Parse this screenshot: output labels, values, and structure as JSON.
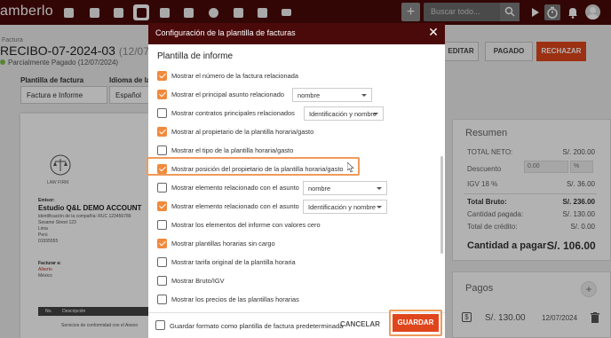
{
  "app": {
    "brand": "amberlo"
  },
  "topbar": {
    "search_placeholder": "Buscar todo...",
    "add_label": "+"
  },
  "document": {
    "label": "Factura",
    "title": "RECIBO-07-2024-03",
    "title_date": "(12/07/2024)",
    "status": "Parcialmente Pagado (12/07/2024)",
    "buttons": {
      "edit": "EDITAR",
      "paid": "PAGADO",
      "reject": "RECHAZAR"
    },
    "template_label": "Plantilla de factura",
    "template_value": "Factura e Informe",
    "language_label": "Idioma de la",
    "language_value": "Español"
  },
  "paper": {
    "firm_name": "LAW FIRM",
    "emisor_label": "Emisor:",
    "emisor_name": "Estudio Q&L DEMO ACCOUNT",
    "company_id": "identificación de la compañía: RUC 123456789",
    "street": "Sesame Street 123",
    "city": "Lima",
    "country": "Perú",
    "phone": "01555555",
    "billed_label": "Facturar a:",
    "billed_name": "Alberto",
    "billed_country": "México",
    "table_no": "No.",
    "table_desc": "Descripción",
    "line_desc": "Servicios de conformidad con el Anexo"
  },
  "summary": {
    "title": "Resumen",
    "net_label": "TOTAL NETO:",
    "net_value": "S/. 200.00",
    "discount_label": "Descuento",
    "discount_value": "0.00",
    "discount_unit": "%",
    "igv_label": "IGV 18 %",
    "igv_value": "S/. 36.00",
    "gross_label": "Total Bruto:",
    "gross_value": "S/. 236.00",
    "paid_label": "Cantidad pagada:",
    "paid_value": "S/. 130.00",
    "credit_label": "Total de crédito:",
    "credit_value": "S/. 0.00",
    "due_label": "Cantidad a pagar:",
    "due_value": "S/. 106.00"
  },
  "payments": {
    "title": "Pagos",
    "add_label": "+",
    "amount": "S/. 130.00",
    "date": "12/07/2024"
  },
  "modal": {
    "title": "Configuración de la plantilla de facturas",
    "section": "Plantilla de informe",
    "options": [
      {
        "label": "Mostrar el número de la factura relacionada",
        "checked": true
      },
      {
        "label": "Mostrar el principal asunto relacionado",
        "checked": true,
        "select": "nombre"
      },
      {
        "label": "Mostrar contratos principales relacionados",
        "checked": false,
        "select": "Identificación y nombre"
      },
      {
        "label": "Mostrar al propietario de la plantilla horaria/gasto",
        "checked": true
      },
      {
        "label": "Mostrar el tipo de la plantilla horaria/gasto",
        "checked": false
      },
      {
        "label": "Mostrar posición del propietario de la plantilla horaria/gasto",
        "checked": true
      },
      {
        "label": "Mostrar elemento relacionado con el asunto",
        "checked": false,
        "select": "nombre"
      },
      {
        "label": "Mostrar elemento relacionado con el asunto",
        "checked": true,
        "select": "Identificación y nombre"
      },
      {
        "label": "Mostrar los elementos del informe con valores cero",
        "checked": false
      },
      {
        "label": "Mostrar plantillas horarias sin cargo",
        "checked": true
      },
      {
        "label": "Mostrar tarifa original de la plantilla horaria",
        "checked": false
      },
      {
        "label": "Mostrar Bruto/IGV",
        "checked": false
      },
      {
        "label": "Mostrar los precios de las plantillas horarias",
        "checked": false
      }
    ],
    "footer_checkbox": "Guardar formato como plantilla de factura predeterminada",
    "cancel": "CANCELAR",
    "save": "GUARDAR"
  }
}
